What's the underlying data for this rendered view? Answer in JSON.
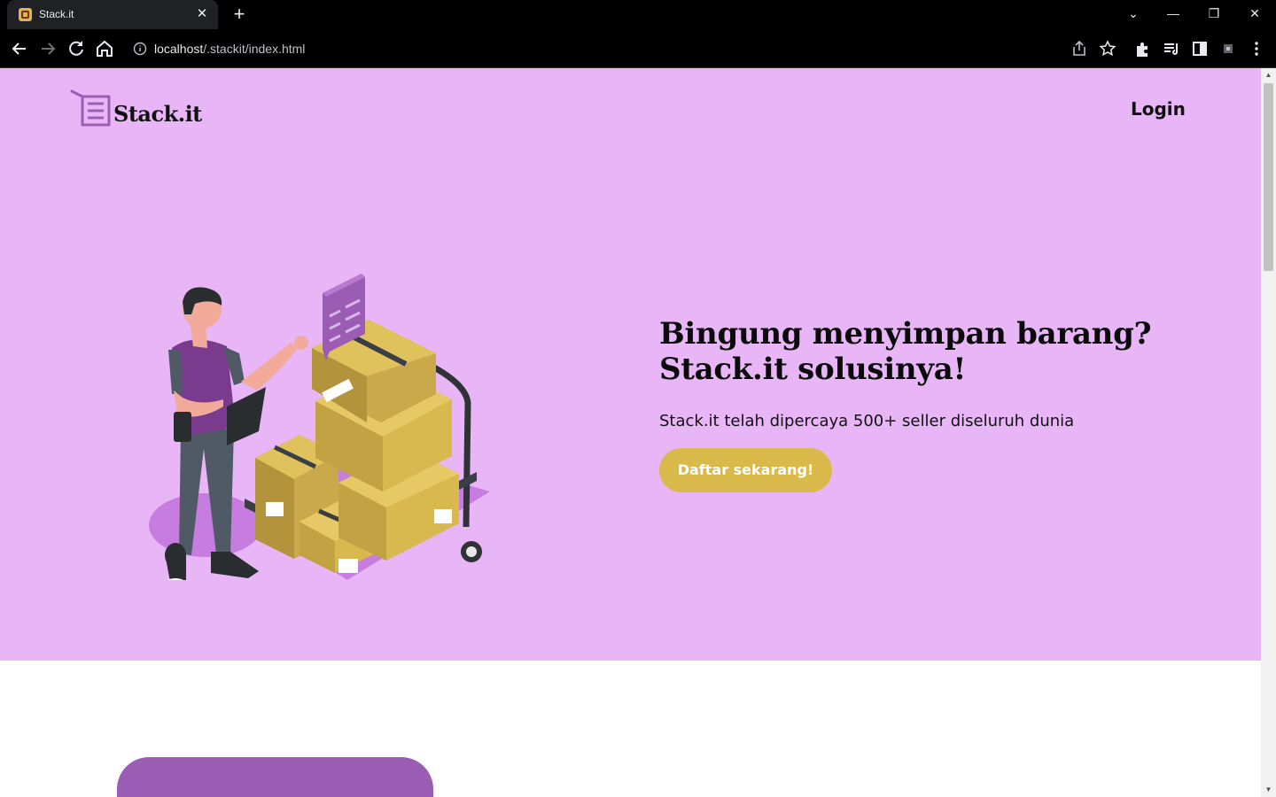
{
  "browser": {
    "tab_title": "Stack.it",
    "url_host": "localhost",
    "url_path": "/.stackit/index.html"
  },
  "page": {
    "logo_text": "Stack.it",
    "nav_login": "Login",
    "headline_line1": "Bingung menyimpan barang?",
    "headline_line2": "Stack.it solusinya!",
    "subtext": "Stack.it telah dipercaya 500+ seller diseluruh dunia",
    "cta_label": "Daftar sekarang!"
  },
  "colors": {
    "hero_bg": "#e8b6f6",
    "accent": "#d9b94a",
    "purple": "#9b5cb4"
  }
}
